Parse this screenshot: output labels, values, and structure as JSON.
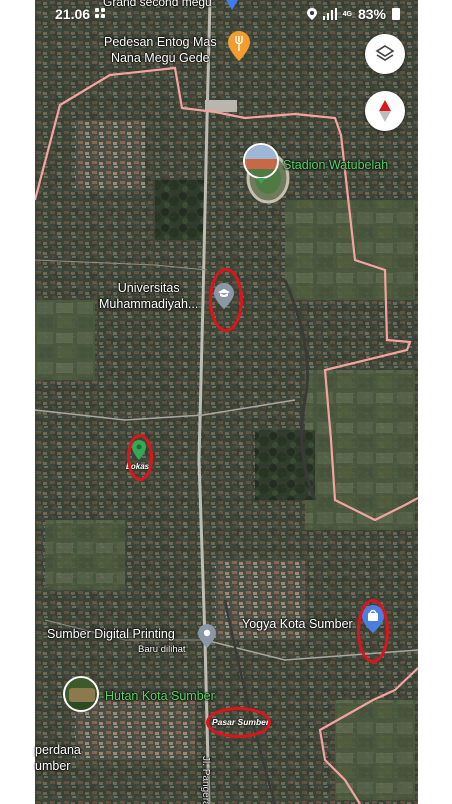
{
  "status_bar": {
    "time": "21.06",
    "signal": "4G",
    "battery": "83%"
  },
  "top_partial_label": "Grand second megu",
  "places": {
    "pedesan": "Pedesan Entog Mas\nNana Megu Gede",
    "stadion": "Stadion Watubelah",
    "universitas": "Universitas\nMuhammadiyah...",
    "sumber_digital": "Sumber Digital Printing",
    "sumber_digital_sub": "Baru dilihat",
    "yogya": "Yogya Kota Sumber",
    "hutan": "Hutan Kota Sumber",
    "perdana": "perdana\number",
    "road": "Jl. Pangeran K"
  },
  "annotations": {
    "lokasi": "Lokasi",
    "pasar": "Pasar Sumber"
  },
  "colors": {
    "boundary": "#f4a3a0",
    "annotation_ring": "#e0131b",
    "park_label": "#58d36a",
    "lokasi_pin": "#34a853",
    "pin_gray": "#8a98a6",
    "pin_blue": "#4a7fe0"
  },
  "icons": [
    "layers-icon",
    "compass-icon",
    "restaurant-pin-icon",
    "university-pin-icon",
    "shopping-pin-icon",
    "location-pin-icon",
    "stadium-thumbnail-icon",
    "park-thumbnail-icon"
  ]
}
